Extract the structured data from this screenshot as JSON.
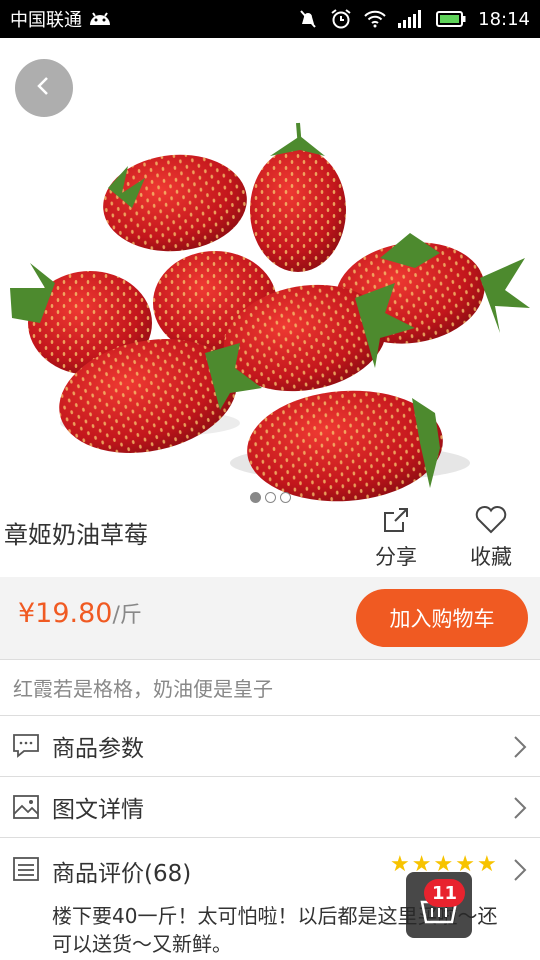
{
  "status_bar": {
    "carrier": "中国联通",
    "time": "18:14",
    "icons": [
      "android-icon",
      "mute-icon",
      "alarm-icon",
      "wifi-icon",
      "signal-icon",
      "battery-icon"
    ]
  },
  "product": {
    "image_icon": "strawberry-photo",
    "carousel": {
      "total": 3,
      "active_index": 0
    },
    "name": "章姬奶油草莓",
    "actions": {
      "share_label": "分享",
      "favorite_label": "收藏"
    },
    "price": "¥19.80",
    "unit": "/斤",
    "add_to_cart_label": "加入购物车",
    "slogan": "红霞若是格格，奶油便是皇子"
  },
  "menu": {
    "params_label": "商品参数",
    "details_label": "图文详情",
    "reviews_label": "商品评价(68)"
  },
  "review": {
    "rating": 5,
    "text": "楼下要40一斤！太可怕啦！以后都是这里买啦～还可以送货～又新鲜。"
  },
  "floating_cart": {
    "count": "11"
  },
  "colors": {
    "accent": "#f05a22",
    "star": "#f7c300",
    "badge": "#e8232e"
  }
}
